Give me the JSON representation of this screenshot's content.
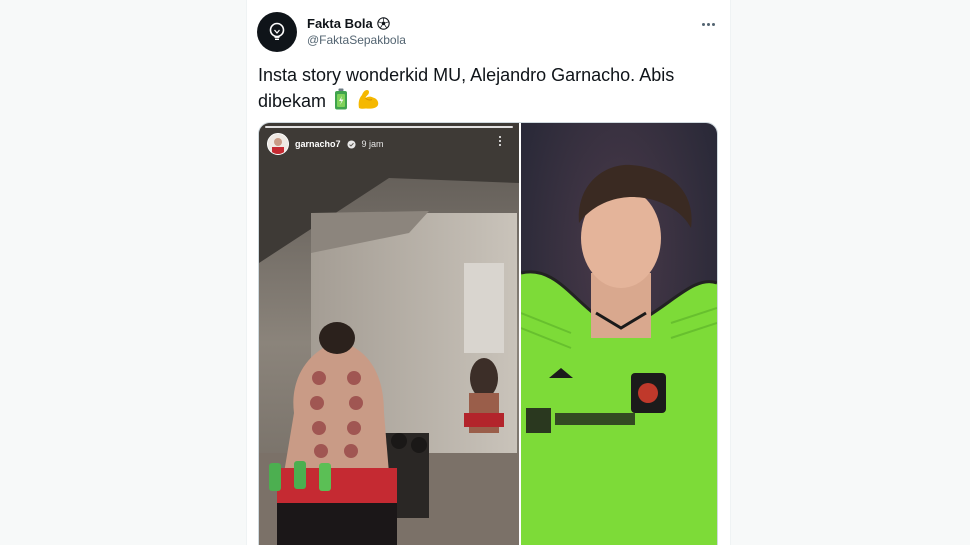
{
  "tweet": {
    "display_name": "Fakta Bola",
    "handle": "@FaktaSepakbola",
    "text": "Insta story wonderkid MU, Alejandro Garnacho. Abis dibekam",
    "emojis": [
      "battery-icon",
      "flexed-biceps-icon"
    ],
    "avatar_icon": "lightbulb-icon",
    "name_badge_icon": "soccer-ball-icon",
    "more_icon": "more-dots-icon"
  },
  "story": {
    "username": "garnacho7",
    "time": "9 jam",
    "verified_icon": "verified-icon"
  },
  "colors": {
    "text": "#0f1419",
    "secondary": "#536471",
    "jersey_green": "#7ddb38"
  }
}
